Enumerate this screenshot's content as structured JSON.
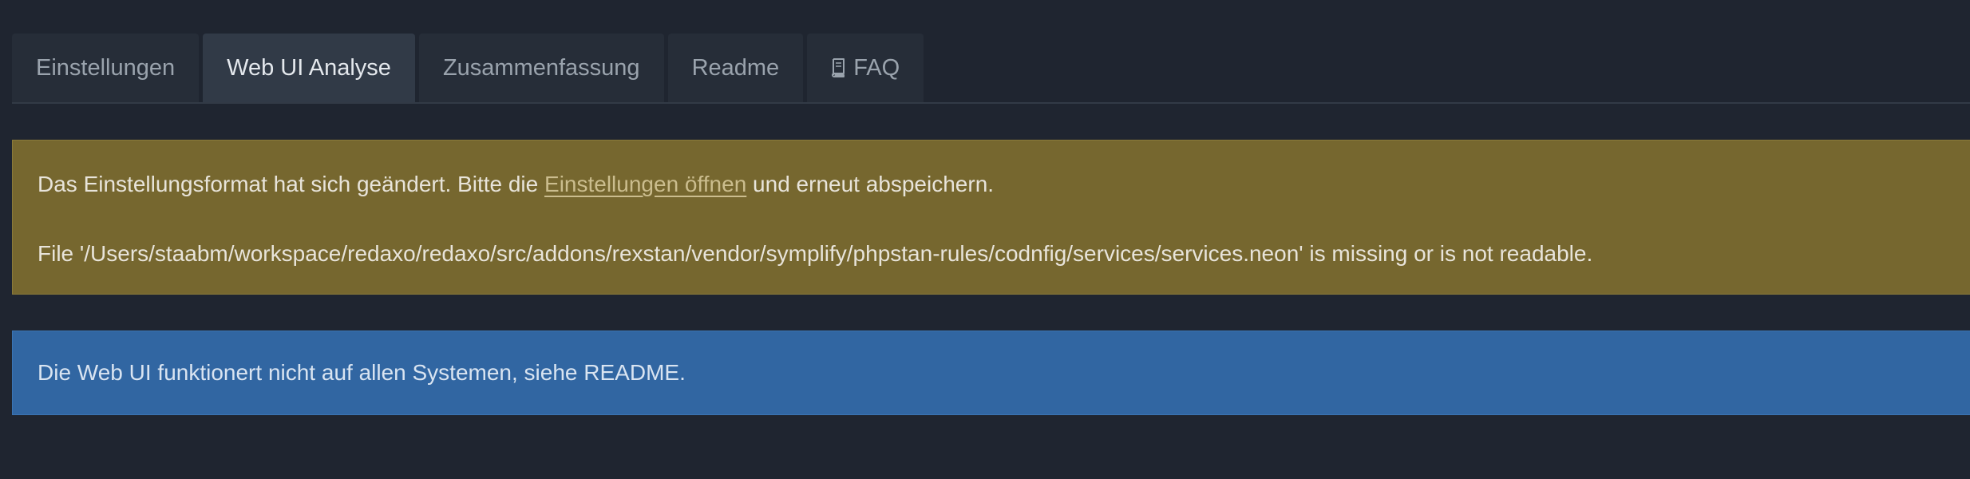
{
  "tabs": [
    {
      "label": "Einstellungen",
      "active": false
    },
    {
      "label": "Web UI Analyse",
      "active": true
    },
    {
      "label": "Zusammenfassung",
      "active": false
    },
    {
      "label": "Readme",
      "active": false
    },
    {
      "label": "FAQ",
      "active": false,
      "icon": "book-icon"
    }
  ],
  "warning": {
    "text_before": "Das Einstellungsformat hat sich geändert. Bitte die ",
    "link": "Einstellungen öffnen",
    "text_after": " und erneut abspeichern.",
    "message": "File '/Users/staabm/workspace/redaxo/redaxo/src/addons/rexstan/vendor/symplify/phpstan-rules/codnfig/services/services.neon' is missing or is not readable."
  },
  "info": {
    "message": "Die Web UI funktionert nicht auf allen Systemen, siehe README."
  },
  "colors": {
    "background": "#1f2530",
    "warning": "#76672f",
    "info": "#3166a2"
  }
}
